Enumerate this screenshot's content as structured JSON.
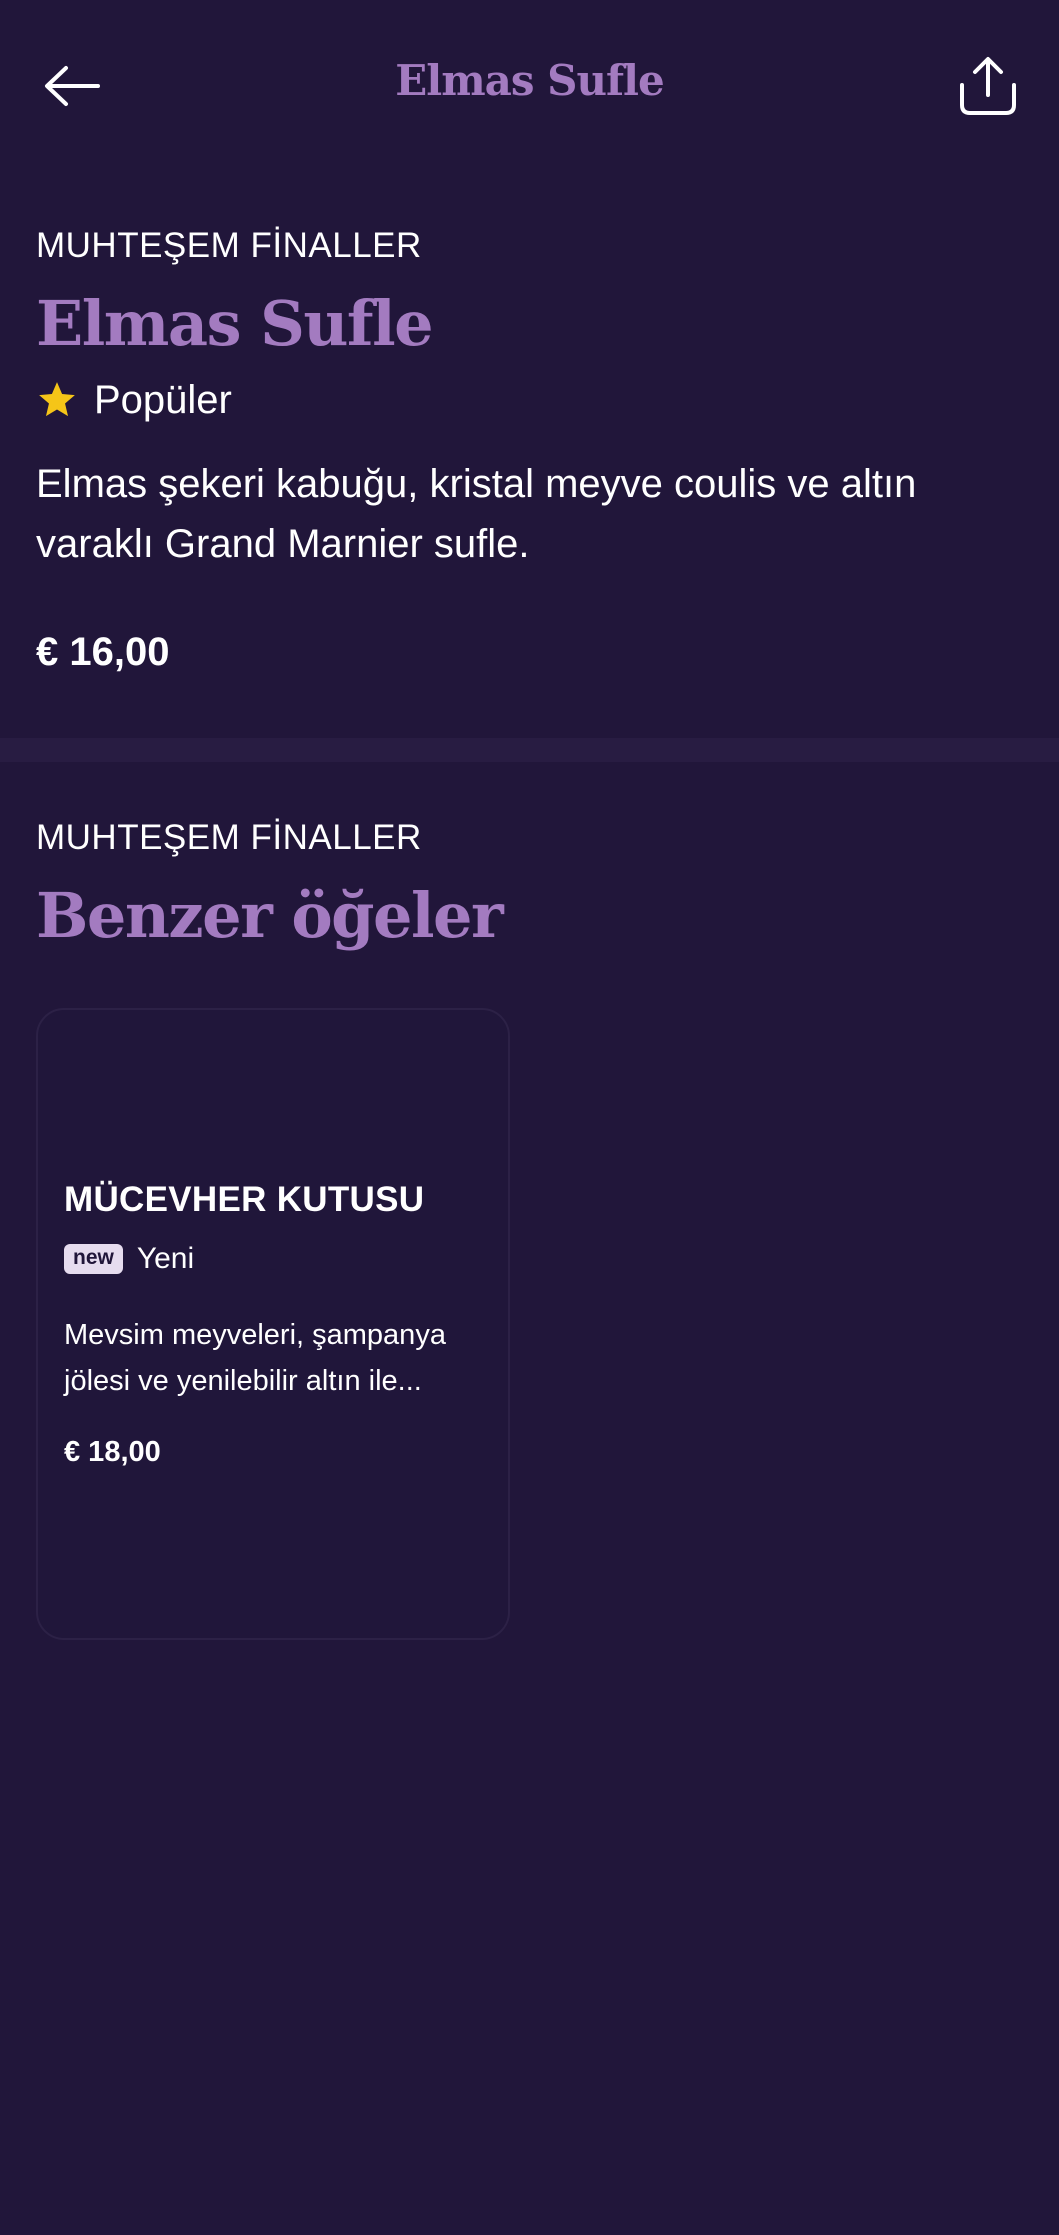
{
  "header": {
    "title": "Elmas Sufle",
    "back_icon": "arrow-left-icon",
    "share_icon": "share-icon"
  },
  "item": {
    "category": "MUHTEŞEM FİNALLER",
    "name": "Elmas Sufle",
    "badge": {
      "icon": "star-icon",
      "label": "Popüler"
    },
    "description": "Elmas şekeri kabuğu, kristal meyve coulis ve altın varaklı Grand Marnier sufle.",
    "price": "€ 16,00"
  },
  "similar": {
    "category": "MUHTEŞEM FİNALLER",
    "title": "Benzer öğeler",
    "items": [
      {
        "name": "MÜCEVHER KUTUSU",
        "tag": "new",
        "tag_label": "Yeni",
        "description": "Mevsim meyveleri, şampanya jölesi ve yenilebilir altın ile...",
        "price": "€ 18,00"
      }
    ]
  },
  "colors": {
    "background": "#21163a",
    "accent": "#a37bc0",
    "star": "#f5c518",
    "divider": "#281c42"
  }
}
